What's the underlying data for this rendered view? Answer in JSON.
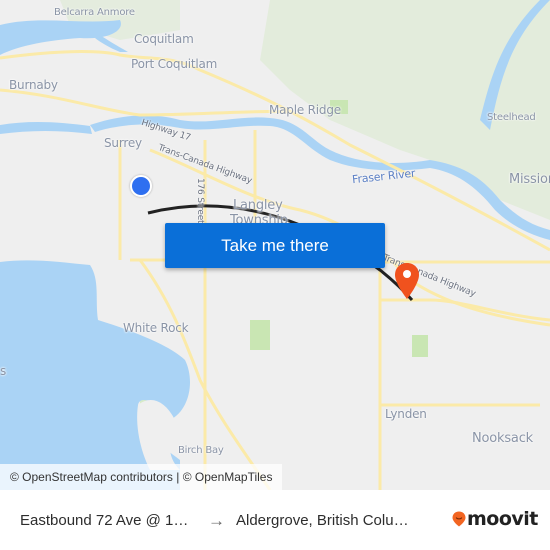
{
  "map": {
    "labels": {
      "belcarra": "Belcarra",
      "anmore": "Anmore",
      "coquitlam": "Coquitlam",
      "port_coquitlam": "Port Coquitlam",
      "burnaby": "Burnaby",
      "maple_ridge": "Maple Ridge",
      "steelhead": "Steelhead",
      "highway_17": "Highway 17",
      "surrey": "Surrey",
      "trans_canada_1": "Trans-Canada Highway",
      "fraser_river": "Fraser River",
      "mission": "Mission",
      "street_176": "176 Street",
      "langley_1": "Langley",
      "langley_2": "Township",
      "trans_canada_2": "Trans-Canada Highway",
      "white_rock": "White Rock",
      "lynden": "Lynden",
      "nooksack": "Nooksack",
      "birch_bay": "Birch Bay",
      "left_edge": "s"
    },
    "attribution": "© OpenStreetMap contributors | © OpenMapTiles",
    "cta_label": "Take me there",
    "colors": {
      "origin_marker": "#2e6ff0",
      "destination_marker": "#f0521e",
      "cta": "#0a6fd8",
      "water": "#aad3f5",
      "park": "#c9e6b3"
    }
  },
  "footer": {
    "origin": "Eastbound 72 Ave @ 1…",
    "arrow": "→",
    "destination": "Aldergrove, British Colu…",
    "brand": "moovit",
    "brand_color": "#f26522"
  }
}
